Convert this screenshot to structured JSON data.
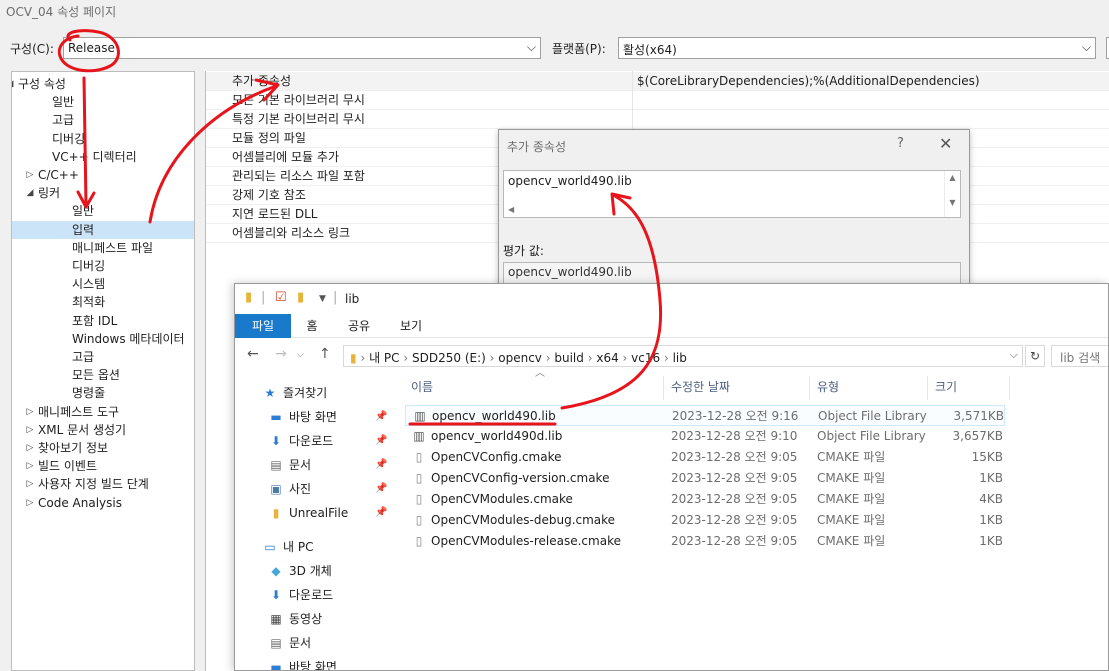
{
  "window": {
    "title": "OCV_04 속성 페이지"
  },
  "config": {
    "config_label": "구성(C):",
    "config_value": "Release",
    "platform_label": "플랫폼(P):",
    "platform_value": "활성(x64)"
  },
  "tree": {
    "items": [
      {
        "label": "구성 속성",
        "arrow": "◢"
      },
      {
        "label": "일반"
      },
      {
        "label": "고급"
      },
      {
        "label": "디버깅"
      },
      {
        "label": "VC++ 디렉터리"
      },
      {
        "label": "C/C++",
        "arrow": "▷"
      },
      {
        "label": "링커",
        "arrow": "◢"
      },
      {
        "label": "일반"
      },
      {
        "label": "입력"
      },
      {
        "label": "매니페스트 파일"
      },
      {
        "label": "디버깅"
      },
      {
        "label": "시스템"
      },
      {
        "label": "최적화"
      },
      {
        "label": "포함 IDL"
      },
      {
        "label": "Windows 메타데이터"
      },
      {
        "label": "고급"
      },
      {
        "label": "모든 옵션"
      },
      {
        "label": "명령줄"
      },
      {
        "label": "매니페스트 도구",
        "arrow": "▷"
      },
      {
        "label": "XML 문서 생성기",
        "arrow": "▷"
      },
      {
        "label": "찾아보기 정보",
        "arrow": "▷"
      },
      {
        "label": "빌드 이벤트",
        "arrow": "▷"
      },
      {
        "label": "사용자 지정 빌드 단계",
        "arrow": "▷"
      },
      {
        "label": "Code Analysis",
        "arrow": "▷"
      }
    ]
  },
  "grid": {
    "rows": [
      {
        "name": "추가 종속성",
        "value": "$(CoreLibraryDependencies);%(AdditionalDependencies)"
      },
      {
        "name": "모든 기본 라이브러리 무시",
        "value": ""
      },
      {
        "name": "특정 기본 라이브러리 무시",
        "value": ""
      },
      {
        "name": "모듈 정의 파일",
        "value": ""
      },
      {
        "name": "어셈블리에 모듈 추가",
        "value": ""
      },
      {
        "name": "관리되는 리소스 파일 포함",
        "value": ""
      },
      {
        "name": "강제 기호 참조",
        "value": ""
      },
      {
        "name": "지연 로드된 DLL",
        "value": ""
      },
      {
        "name": "어셈블리와 리소스 링크",
        "value": ""
      }
    ]
  },
  "dialog": {
    "title": "추가 종속성",
    "help": "?",
    "close": "✕",
    "text_value": "opencv_world490.lib",
    "eval_label": "평가 값:",
    "eval_value": "opencv_world490.lib"
  },
  "explorer": {
    "title": "lib",
    "ribbon_tabs": [
      "파일",
      "홈",
      "공유",
      "보기"
    ],
    "address": [
      "내 PC",
      "SDD250 (E:)",
      "opencv",
      "build",
      "x64",
      "vc16",
      "lib"
    ],
    "search_placeholder": "lib 검색",
    "columns": [
      "이름",
      "수정한 날짜",
      "유형",
      "크기"
    ],
    "nav_items": [
      {
        "label": "즐겨찾기",
        "icon": "★",
        "pinned": false
      },
      {
        "label": "바탕 화면",
        "icon": "▬",
        "pinned": true
      },
      {
        "label": "다운로드",
        "icon": "⬇",
        "pinned": true
      },
      {
        "label": "문서",
        "icon": "▤",
        "pinned": true
      },
      {
        "label": "사진",
        "icon": "▣",
        "pinned": true
      },
      {
        "label": "UnrealFile",
        "icon": "▮",
        "pinned": true
      },
      {
        "label": "내 PC",
        "icon": "▭",
        "pinned": false
      },
      {
        "label": "3D 개체",
        "icon": "◆",
        "pinned": false
      },
      {
        "label": "다운로드",
        "icon": "⬇",
        "pinned": false
      },
      {
        "label": "동영상",
        "icon": "▦",
        "pinned": false
      },
      {
        "label": "문서",
        "icon": "▤",
        "pinned": false
      },
      {
        "label": "바탕 화면",
        "icon": "▬",
        "pinned": false
      }
    ],
    "files": [
      {
        "name": "opencv_world490.lib",
        "modified": "2023-12-28 오전 9:16",
        "type": "Object File Library",
        "size": "3,571KB"
      },
      {
        "name": "opencv_world490d.lib",
        "modified": "2023-12-28 오전 9:10",
        "type": "Object File Library",
        "size": "3,657KB"
      },
      {
        "name": "OpenCVConfig.cmake",
        "modified": "2023-12-28 오전 9:05",
        "type": "CMAKE 파일",
        "size": "15KB"
      },
      {
        "name": "OpenCVConfig-version.cmake",
        "modified": "2023-12-28 오전 9:05",
        "type": "CMAKE 파일",
        "size": "1KB"
      },
      {
        "name": "OpenCVModules.cmake",
        "modified": "2023-12-28 오전 9:05",
        "type": "CMAKE 파일",
        "size": "4KB"
      },
      {
        "name": "OpenCVModules-debug.cmake",
        "modified": "2023-12-28 오전 9:05",
        "type": "CMAKE 파일",
        "size": "1KB"
      },
      {
        "name": "OpenCVModules-release.cmake",
        "modified": "2023-12-28 오전 9:05",
        "type": "CMAKE 파일",
        "size": "1KB"
      }
    ]
  },
  "colors": {
    "annotation": "#e8141b",
    "ribbon_active": "#1979ca",
    "selection": "#cce4f7"
  }
}
